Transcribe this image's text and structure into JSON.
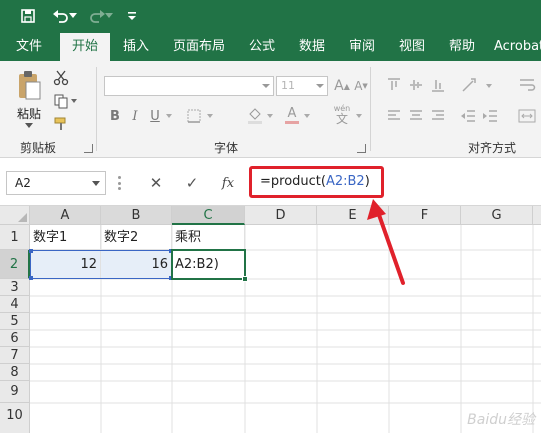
{
  "colors": {
    "brand": "#217346",
    "accent_red": "#e0212b",
    "range_blue": "#3a66c4"
  },
  "quick_access": {
    "save_icon": "save-icon",
    "undo_icon": "undo-icon",
    "redo_icon": "redo-icon",
    "customize_icon": "customize-qat-icon"
  },
  "tabs": [
    {
      "label": "文件",
      "active": false
    },
    {
      "label": "开始",
      "active": true
    },
    {
      "label": "插入",
      "active": false
    },
    {
      "label": "页面布局",
      "active": false
    },
    {
      "label": "公式",
      "active": false
    },
    {
      "label": "数据",
      "active": false
    },
    {
      "label": "审阅",
      "active": false
    },
    {
      "label": "视图",
      "active": false
    },
    {
      "label": "帮助",
      "active": false
    },
    {
      "label": "Acrobat",
      "active": false
    }
  ],
  "ribbon": {
    "clipboard": {
      "paste_label": "粘贴",
      "group_label": "剪贴板"
    },
    "font": {
      "group_label": "字体",
      "font_size": "11",
      "bold": "B",
      "italic": "I",
      "underline": "U",
      "grow": "A",
      "shrink": "A",
      "color_a": "A",
      "wen": "wén",
      "wen_char": "文"
    },
    "alignment": {
      "group_label": "对齐方式"
    }
  },
  "formula_bar": {
    "name_box": "A2",
    "cancel": "✕",
    "enter": "✓",
    "fx": "fx",
    "formula_prefix": "=product(",
    "formula_ref": "A2:B2",
    "formula_suffix": ")"
  },
  "sheet": {
    "columns": [
      "A",
      "B",
      "C",
      "D",
      "E",
      "F",
      "G"
    ],
    "rows": [
      "1",
      "2",
      "3",
      "4",
      "5",
      "6",
      "7",
      "8",
      "9",
      "10"
    ],
    "cells": {
      "A1": "数字1",
      "B1": "数字2",
      "C1": "乘积",
      "A2": "12",
      "B2": "16",
      "C2": "A2:B2)"
    }
  },
  "watermark": "Baidu经验"
}
